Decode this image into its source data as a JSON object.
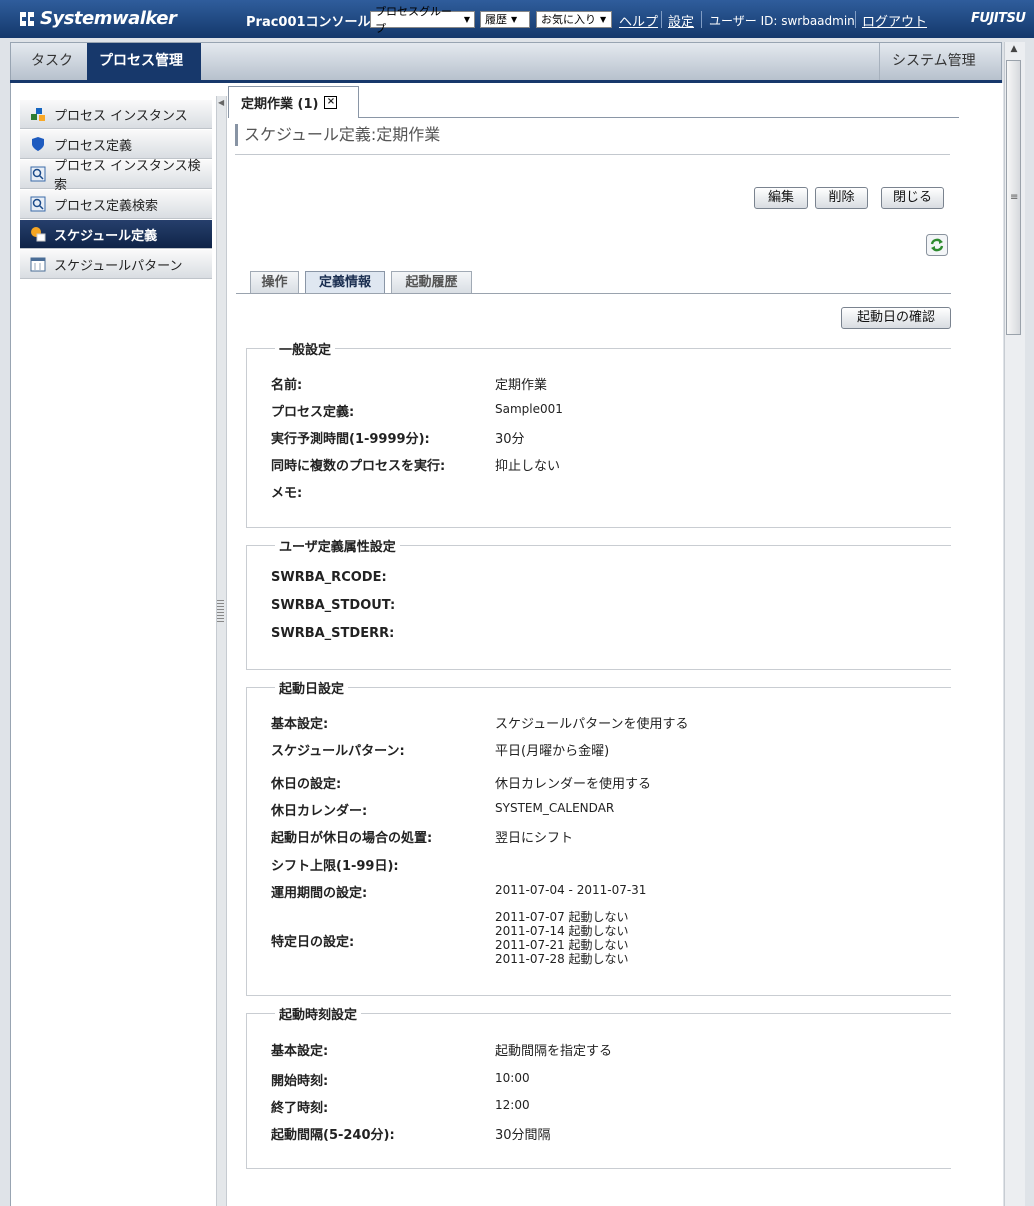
{
  "header": {
    "brand": "Systemwalker",
    "console_title": "Prac001コンソール",
    "dropdowns": [
      "プロセスグループ",
      "履歴",
      "お気に入り"
    ],
    "links": [
      "ヘルプ",
      "設定"
    ],
    "user_label": "ユーザー ID: swrbaadmin",
    "logout": "ログアウト",
    "vendor": "FUJITSU"
  },
  "nav": {
    "task": "タスク",
    "process": "プロセス管理",
    "system": "システム管理"
  },
  "sidebar": {
    "items": [
      {
        "label": "プロセス インスタンス"
      },
      {
        "label": "プロセス定義"
      },
      {
        "label": "プロセス インスタンス検索"
      },
      {
        "label": "プロセス定義検索"
      },
      {
        "label": "スケジュール定義"
      },
      {
        "label": "スケジュールパターン"
      }
    ]
  },
  "doc_tab": "定期作業 (1)",
  "page_title": "スケジュール定義:定期作業",
  "buttons": {
    "edit": "編集",
    "delete": "削除",
    "close": "閉じる",
    "check_dates": "起動日の確認"
  },
  "sub_tabs": [
    "操作",
    "定義情報",
    "起動履歴"
  ],
  "general": {
    "legend": "一般設定",
    "rows": [
      {
        "label": "名前:",
        "value": "定期作業"
      },
      {
        "label": "プロセス定義:",
        "value": "Sample001"
      },
      {
        "label": "実行予測時間(1-9999分):",
        "value": "30分"
      },
      {
        "label": "同時に複数のプロセスを実行:",
        "value": "抑止しない"
      },
      {
        "label": "メモ:",
        "value": ""
      }
    ]
  },
  "user_attrs": {
    "legend": "ユーザ定義属性設定",
    "rows": [
      {
        "label": "SWRBA_RCODE:"
      },
      {
        "label": "SWRBA_STDOUT:"
      },
      {
        "label": "SWRBA_STDERR:"
      }
    ]
  },
  "start_date": {
    "legend": "起動日設定",
    "rows": [
      {
        "label": "基本設定:",
        "value": "スケジュールパターンを使用する"
      },
      {
        "label": "スケジュールパターン:",
        "value": "平日(月曜から金曜)"
      },
      {
        "label": "休日の設定:",
        "value": "休日カレンダーを使用する"
      },
      {
        "label": "休日カレンダー:",
        "value": "SYSTEM_CALENDAR"
      },
      {
        "label": "起動日が休日の場合の処置:",
        "value": "翌日にシフト"
      },
      {
        "label": "シフト上限(1-99日):",
        "value": ""
      },
      {
        "label": "運用期間の設定:",
        "value": "2011-07-04 - 2011-07-31"
      },
      {
        "label": "特定日の設定:",
        "lines": [
          "2011-07-07 起動しない",
          "2011-07-14 起動しない",
          "2011-07-21 起動しない",
          "2011-07-28 起動しない"
        ]
      }
    ]
  },
  "start_time": {
    "legend": "起動時刻設定",
    "rows": [
      {
        "label": "基本設定:",
        "value": "起動間隔を指定する"
      },
      {
        "label": "開始時刻:",
        "value": "10:00"
      },
      {
        "label": "終了時刻:",
        "value": "12:00"
      },
      {
        "label": "起動間隔(5-240分):",
        "value": "30分間隔"
      }
    ]
  }
}
